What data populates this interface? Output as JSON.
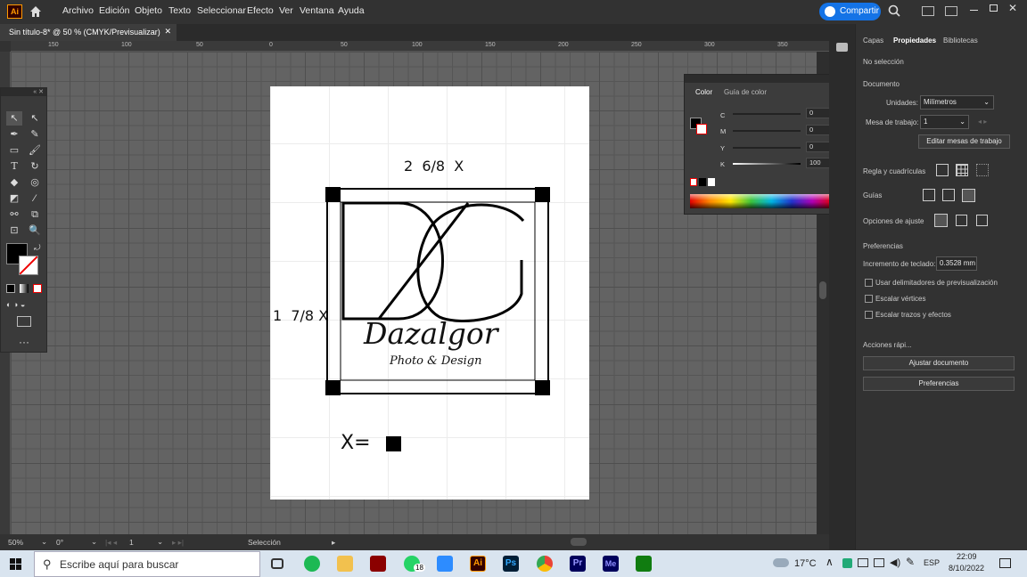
{
  "app": {
    "logo": "Ai",
    "menus": [
      "Archivo",
      "Edición",
      "Objeto",
      "Texto",
      "Seleccionar",
      "Efecto",
      "Ver",
      "Ventana",
      "Ayuda"
    ],
    "share_label": "Compartir"
  },
  "doc_tab": {
    "title": "Sin título-8* @ 50 % (CMYK/Previsualizar)"
  },
  "ruler_top": [
    "150",
    "100",
    "50",
    "0",
    "50",
    "100",
    "150",
    "200",
    "250",
    "300",
    "350",
    "400",
    "450"
  ],
  "artwork": {
    "width_label": "2  6/8  X",
    "height_label": "1  7/8 X",
    "unit_label": "X=",
    "brand": "Dazalgor",
    "tagline": "Photo & Design"
  },
  "status": {
    "zoom": "50%",
    "rotation": "0°",
    "page": "1",
    "tool": "Selección"
  },
  "color_panel": {
    "tabs": [
      "Color",
      "Guía de color"
    ],
    "channels": [
      {
        "name": "C",
        "value": "0"
      },
      {
        "name": "M",
        "value": "0"
      },
      {
        "name": "Y",
        "value": "0"
      },
      {
        "name": "K",
        "value": "100"
      }
    ],
    "pct": "%"
  },
  "props": {
    "tabs": [
      "Capas",
      "Propiedades",
      "Bibliotecas"
    ],
    "no_selection": "No selección",
    "document": "Documento",
    "units_label": "Unidades:",
    "units_value": "Milímetros",
    "artboard_label": "Mesa de trabajo:",
    "artboard_value": "1",
    "edit_artboards": "Editar mesas de trabajo",
    "rulers_grids": "Regla y cuadrículas",
    "guides": "Guías",
    "snap": "Opciones de ajuste",
    "prefs_heading": "Preferencias",
    "keyboard_inc_label": "Incremento de teclado:",
    "keyboard_inc_value": "0.3528 mm",
    "check1": "Usar delimitadores de previsualización",
    "check2": "Escalar vértices",
    "check3": "Escalar trazos y efectos",
    "quick_actions": "Acciones rápi...",
    "fit_document": "Ajustar documento",
    "preferences_btn": "Preferencias"
  },
  "taskbar": {
    "search_placeholder": "Escribe aquí para buscar",
    "weather": "17°C",
    "lang": "ESP",
    "time": "22:09",
    "date": "8/10/2022",
    "whatsapp_badge": "18"
  }
}
